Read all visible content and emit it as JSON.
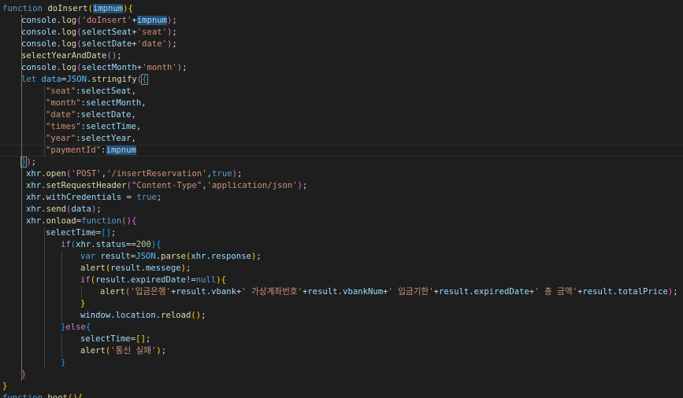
{
  "editor": {
    "theme": "dark",
    "lines": [
      {
        "indent": 0,
        "tokens": [
          [
            "kw",
            "function"
          ],
          [
            "pun",
            " "
          ],
          [
            "fn",
            "doInsert"
          ],
          [
            "b1",
            "("
          ],
          [
            "var",
            "impnum",
            "sel"
          ],
          [
            "b1",
            ")"
          ],
          [
            "b1",
            "{"
          ]
        ]
      },
      {
        "indent": 24,
        "tokens": [
          [
            "var",
            "console"
          ],
          [
            "pun",
            "."
          ],
          [
            "fn",
            "log"
          ],
          [
            "b2",
            "("
          ],
          [
            "str",
            "'doInsert'"
          ],
          [
            "pun",
            "+"
          ],
          [
            "var",
            "impnum",
            "sel"
          ],
          [
            "b2",
            ")"
          ],
          [
            "pun",
            ";"
          ]
        ]
      },
      {
        "indent": 24,
        "tokens": [
          [
            "var",
            "console"
          ],
          [
            "pun",
            "."
          ],
          [
            "fn",
            "log"
          ],
          [
            "b2",
            "("
          ],
          [
            "var",
            "selectSeat"
          ],
          [
            "pun",
            "+"
          ],
          [
            "str",
            "'seat'"
          ],
          [
            "b2",
            ")"
          ],
          [
            "pun",
            ";"
          ]
        ]
      },
      {
        "indent": 24,
        "tokens": [
          [
            "var",
            "console"
          ],
          [
            "pun",
            "."
          ],
          [
            "fn",
            "log"
          ],
          [
            "b2",
            "("
          ],
          [
            "var",
            "selectDate"
          ],
          [
            "pun",
            "+"
          ],
          [
            "str",
            "'date'"
          ],
          [
            "b2",
            ")"
          ],
          [
            "pun",
            ";"
          ]
        ]
      },
      {
        "indent": 24,
        "tokens": [
          [
            "fn",
            "selectYearAndDate"
          ],
          [
            "b2",
            "("
          ],
          [
            "b2",
            ")"
          ],
          [
            "pun",
            ";"
          ]
        ]
      },
      {
        "indent": 24,
        "tokens": [
          [
            "var",
            "console"
          ],
          [
            "pun",
            "."
          ],
          [
            "fn",
            "log"
          ],
          [
            "b2",
            "("
          ],
          [
            "var",
            "selectMonth"
          ],
          [
            "pun",
            "+"
          ],
          [
            "str",
            "'month'"
          ],
          [
            "b2",
            ")"
          ],
          [
            "pun",
            ";"
          ]
        ]
      },
      {
        "indent": 24,
        "tokens": [
          [
            "kw",
            "let"
          ],
          [
            "pun",
            " "
          ],
          [
            "const",
            "data"
          ],
          [
            "pun",
            "="
          ],
          [
            "const",
            "JSON"
          ],
          [
            "pun",
            "."
          ],
          [
            "fn",
            "stringify"
          ],
          [
            "b2",
            "("
          ],
          [
            "b3",
            "{",
            "box"
          ]
        ]
      },
      {
        "indent": 55,
        "tokens": [
          [
            "str",
            "\"seat\""
          ],
          [
            "pun",
            ":"
          ],
          [
            "var",
            "selectSeat"
          ],
          [
            "pun",
            ","
          ]
        ]
      },
      {
        "indent": 55,
        "tokens": [
          [
            "str",
            "\"month\""
          ],
          [
            "pun",
            ":"
          ],
          [
            "var",
            "selectMonth"
          ],
          [
            "pun",
            ","
          ]
        ]
      },
      {
        "indent": 55,
        "tokens": [
          [
            "str",
            "\"date\""
          ],
          [
            "pun",
            ":"
          ],
          [
            "var",
            "selectDate"
          ],
          [
            "pun",
            ","
          ]
        ]
      },
      {
        "indent": 55,
        "tokens": [
          [
            "str",
            "\"times\""
          ],
          [
            "pun",
            ":"
          ],
          [
            "var",
            "selectTime"
          ],
          [
            "pun",
            ","
          ]
        ]
      },
      {
        "indent": 55,
        "tokens": [
          [
            "str",
            "\"year\""
          ],
          [
            "pun",
            ":"
          ],
          [
            "var",
            "selectYear"
          ],
          [
            "pun",
            ","
          ]
        ]
      },
      {
        "indent": 55,
        "tokens": [
          [
            "str",
            "\"paymentId\""
          ],
          [
            "pun",
            ":"
          ],
          [
            "var",
            "impnum",
            "sel"
          ]
        ]
      },
      {
        "indent": 24,
        "tokens": [
          [
            "b3",
            "}",
            "box"
          ],
          [
            "b2",
            ")"
          ],
          [
            "pun",
            ";"
          ]
        ]
      },
      {
        "indent": 30,
        "tokens": [
          [
            "var",
            "xhr"
          ],
          [
            "pun",
            "."
          ],
          [
            "fn",
            "open"
          ],
          [
            "b2",
            "("
          ],
          [
            "str",
            "'POST'"
          ],
          [
            "pun",
            ","
          ],
          [
            "str",
            "'/insertReservation'"
          ],
          [
            "pun",
            ","
          ],
          [
            "kw",
            "true"
          ],
          [
            "b2",
            ")"
          ],
          [
            "pun",
            ";"
          ]
        ]
      },
      {
        "indent": 30,
        "tokens": [
          [
            "var",
            "xhr"
          ],
          [
            "pun",
            "."
          ],
          [
            "fn",
            "setRequestHeader"
          ],
          [
            "b2",
            "("
          ],
          [
            "str",
            "\"Content-Type\""
          ],
          [
            "pun",
            ","
          ],
          [
            "str",
            "'application/json'"
          ],
          [
            "b2",
            ")"
          ],
          [
            "pun",
            ";"
          ]
        ]
      },
      {
        "indent": 30,
        "tokens": [
          [
            "var",
            "xhr"
          ],
          [
            "pun",
            "."
          ],
          [
            "var",
            "withCredentials"
          ],
          [
            "pun",
            " = "
          ],
          [
            "kw",
            "true"
          ],
          [
            "pun",
            ";"
          ]
        ]
      },
      {
        "indent": 30,
        "tokens": [
          [
            "var",
            "xhr"
          ],
          [
            "pun",
            "."
          ],
          [
            "fn",
            "send"
          ],
          [
            "b2",
            "("
          ],
          [
            "var",
            "data"
          ],
          [
            "b2",
            ")"
          ],
          [
            "pun",
            ";"
          ]
        ]
      },
      {
        "indent": 30,
        "tokens": [
          [
            "var",
            "xhr"
          ],
          [
            "pun",
            "."
          ],
          [
            "fn",
            "onload"
          ],
          [
            "pun",
            "="
          ],
          [
            "kw",
            "function"
          ],
          [
            "b2",
            "("
          ],
          [
            "b2",
            ")"
          ],
          [
            "b2",
            "{"
          ]
        ]
      },
      {
        "indent": 55,
        "tokens": [
          [
            "var",
            "selectTime"
          ],
          [
            "pun",
            "="
          ],
          [
            "b3",
            "["
          ],
          [
            "b3",
            "]"
          ],
          [
            "pun",
            ";"
          ]
        ]
      },
      {
        "indent": 74,
        "tokens": [
          [
            "ctl",
            "if"
          ],
          [
            "b3",
            "("
          ],
          [
            "var",
            "xhr"
          ],
          [
            "pun",
            "."
          ],
          [
            "var",
            "status"
          ],
          [
            "pun",
            "=="
          ],
          [
            "num",
            "200"
          ],
          [
            "b3",
            ")"
          ],
          [
            "b3",
            "{"
          ]
        ]
      },
      {
        "indent": 99,
        "tokens": [
          [
            "kw",
            "var"
          ],
          [
            "pun",
            " "
          ],
          [
            "var",
            "result"
          ],
          [
            "pun",
            "="
          ],
          [
            "const",
            "JSON"
          ],
          [
            "pun",
            "."
          ],
          [
            "fn",
            "parse"
          ],
          [
            "b1",
            "("
          ],
          [
            "var",
            "xhr"
          ],
          [
            "pun",
            "."
          ],
          [
            "var",
            "response"
          ],
          [
            "b1",
            ")"
          ],
          [
            "pun",
            ";"
          ]
        ]
      },
      {
        "indent": 99,
        "tokens": [
          [
            "fn",
            "alert"
          ],
          [
            "b1",
            "("
          ],
          [
            "var",
            "result"
          ],
          [
            "pun",
            "."
          ],
          [
            "var",
            "messege"
          ],
          [
            "b1",
            ")"
          ],
          [
            "pun",
            ";"
          ]
        ]
      },
      {
        "indent": 99,
        "tokens": [
          [
            "ctl",
            "if"
          ],
          [
            "b1",
            "("
          ],
          [
            "var",
            "result"
          ],
          [
            "pun",
            "."
          ],
          [
            "var",
            "expiredDate"
          ],
          [
            "pun",
            "!="
          ],
          [
            "kw",
            "null"
          ],
          [
            "b1",
            ")"
          ],
          [
            "b1",
            "{"
          ]
        ]
      },
      {
        "indent": 124,
        "tokens": [
          [
            "fn",
            "alert"
          ],
          [
            "b2",
            "("
          ],
          [
            "str",
            "'입금은행'"
          ],
          [
            "pun",
            "+"
          ],
          [
            "var",
            "result"
          ],
          [
            "pun",
            "."
          ],
          [
            "var",
            "vbank"
          ],
          [
            "pun",
            "+"
          ],
          [
            "str",
            "' 가상계좌번호'"
          ],
          [
            "pun",
            "+"
          ],
          [
            "var",
            "result"
          ],
          [
            "pun",
            "."
          ],
          [
            "var",
            "vbankNum"
          ],
          [
            "pun",
            "+"
          ],
          [
            "str",
            "' 입금기한'"
          ],
          [
            "pun",
            "+"
          ],
          [
            "var",
            "result"
          ],
          [
            "pun",
            "."
          ],
          [
            "var",
            "expiredDate"
          ],
          [
            "pun",
            "+"
          ],
          [
            "str",
            "' 총 금액'"
          ],
          [
            "pun",
            "+"
          ],
          [
            "var",
            "result"
          ],
          [
            "pun",
            "."
          ],
          [
            "var",
            "totalPrice"
          ],
          [
            "b2",
            ")"
          ],
          [
            "pun",
            ";"
          ]
        ]
      },
      {
        "indent": 99,
        "tokens": [
          [
            "b1",
            "}"
          ]
        ]
      },
      {
        "indent": 99,
        "tokens": [
          [
            "var",
            "window"
          ],
          [
            "pun",
            "."
          ],
          [
            "var",
            "location"
          ],
          [
            "pun",
            "."
          ],
          [
            "fn",
            "reload"
          ],
          [
            "b1",
            "("
          ],
          [
            "b1",
            ")"
          ],
          [
            "pun",
            ";"
          ]
        ]
      },
      {
        "indent": 74,
        "tokens": [
          [
            "b3",
            "}"
          ],
          [
            "ctl",
            "else"
          ],
          [
            "b3",
            "{"
          ]
        ]
      },
      {
        "indent": 99,
        "tokens": [
          [
            "var",
            "selectTime"
          ],
          [
            "pun",
            "="
          ],
          [
            "b1",
            "["
          ],
          [
            "b1",
            "]"
          ],
          [
            "pun",
            ";"
          ]
        ]
      },
      {
        "indent": 99,
        "tokens": [
          [
            "fn",
            "alert"
          ],
          [
            "b1",
            "("
          ],
          [
            "str",
            "'통신 실패'"
          ],
          [
            "b1",
            ")"
          ],
          [
            "pun",
            ";"
          ]
        ]
      },
      {
        "indent": 74,
        "tokens": [
          [
            "b3",
            "}"
          ]
        ]
      },
      {
        "indent": 24,
        "tokens": [
          [
            "b2",
            "}"
          ]
        ]
      },
      {
        "indent": 0,
        "tokens": [
          [
            "b1",
            "}"
          ]
        ]
      },
      {
        "indent": 0,
        "tokens": [
          [
            "kw",
            "function"
          ],
          [
            "pun",
            " "
          ],
          [
            "fn",
            "boot"
          ],
          [
            "b1",
            "("
          ],
          [
            "b1",
            ")"
          ],
          [
            "b1",
            "{"
          ]
        ]
      }
    ]
  }
}
